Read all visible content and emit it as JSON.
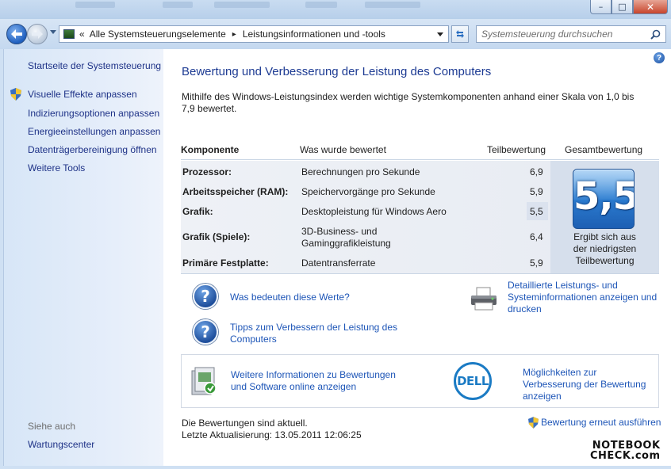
{
  "window": {
    "minimize_glyph": "–",
    "maximize_glyph": "□",
    "close_glyph": "✕"
  },
  "address_bar": {
    "overflow": "«",
    "crumbs": [
      "Alle Systemsteuerungselemente",
      "Leistungsinformationen und -tools"
    ],
    "separator": "▸"
  },
  "search": {
    "placeholder": "Systemsteuerung durchsuchen"
  },
  "sidebar": {
    "home": "Startseite der Systemsteuerung",
    "items": [
      "Visuelle Effekte anpassen",
      "Indizierungsoptionen anpassen",
      "Energieeinstellungen anpassen",
      "Datenträgerbereinigung öffnen",
      "Weitere Tools"
    ],
    "see_also_heading": "Siehe auch",
    "see_also": [
      "Wartungscenter"
    ]
  },
  "main": {
    "title": "Bewertung und Verbesserung der Leistung des Computers",
    "intro": "Mithilfe des Windows-Leistungsindex werden wichtige Systemkomponenten anhand einer Skala von 1,0 bis 7,9 bewertet.",
    "table": {
      "headers": [
        "Komponente",
        "Was wurde bewertet",
        "Teilbewertung",
        "Gesamtbewertung"
      ],
      "rows": [
        {
          "component": "Prozessor:",
          "what": "Berechnungen pro Sekunde",
          "score": "6,9"
        },
        {
          "component": "Arbeitsspeicher (RAM):",
          "what": "Speichervorgänge pro Sekunde",
          "score": "5,9"
        },
        {
          "component": "Grafik:",
          "what": "Desktopleistung für Windows Aero",
          "score": "5,5"
        },
        {
          "component": "Grafik (Spiele):",
          "what_line1": "3D-Business- und",
          "what_line2": "Gaminggrafikleistung",
          "score": "6,4"
        },
        {
          "component": "Primäre Festplatte:",
          "what": "Datentransferrate",
          "score": "5,9"
        }
      ],
      "base_score": "5,5",
      "base_note_1": "Ergibt sich aus",
      "base_note_2": "der niedrigsten",
      "base_note_3": "Teilbewertung"
    },
    "links": {
      "what_mean": "Was bedeuten diese Werte?",
      "tips_1": "Tipps zum Verbessern der Leistung des",
      "tips_2": "Computers",
      "details_1": "Detaillierte Leistungs- und",
      "details_2": "Systeminformationen anzeigen und",
      "details_3": "drucken",
      "more_info_1": "Weitere Informationen zu Bewertungen",
      "more_info_2": "und Software online anzeigen",
      "dell_1": "Möglichkeiten zur",
      "dell_2": "Verbesserung der Bewertung",
      "dell_3": "anzeigen"
    },
    "dell_logo": "DELL",
    "status": "Die Bewertungen sind aktuell.",
    "last_update": "Letzte Aktualisierung: 13.05.2011 12:06:25",
    "rerun": "Bewertung erneut ausführen"
  },
  "watermark": {
    "line1": "NOTEBOOK",
    "line2": "CHECK.com"
  }
}
